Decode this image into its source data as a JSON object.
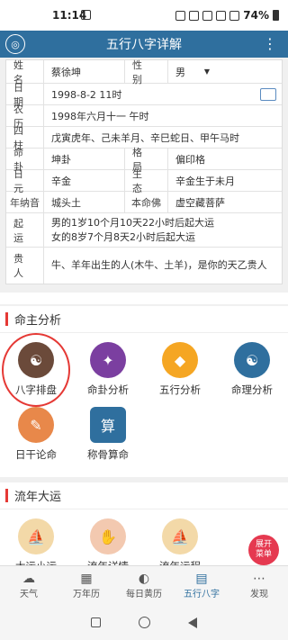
{
  "status": {
    "time": "11:14",
    "battery": "74%"
  },
  "appbar": {
    "title": "五行八字详解"
  },
  "info": {
    "name_label": "姓  名",
    "name_value": "蔡徐坤",
    "gender_label": "性  别",
    "gender_value": "男",
    "date_label": "日  期",
    "date_value": "1998-8-2 11时",
    "lunar_label": "农  历",
    "lunar_value": "1998年六月十一 午时",
    "pillars_label": "四  柱",
    "pillars_value": "戊寅虎年、己未羊月、辛巳蛇日、甲午马时",
    "gua_label": "命  卦",
    "gua_value": "坤卦",
    "geju_label": "格  局",
    "geju_value": "偏印格",
    "riyuan_label": "日  元",
    "riyuan_value": "辛金",
    "shengtai_label": "生  态",
    "shengtai_value": "辛金生于未月",
    "nayin_label": "年纳音",
    "nayin_value": "城头土",
    "benming_label": "本命佛",
    "benming_value": "虚空藏菩萨",
    "qiyun_label": "起  运",
    "qiyun_line1": "男的1岁10个月10天22小时后起大运",
    "qiyun_line2": "女的8岁7个月8天2小时后起大运",
    "guiren_label": "贵  人",
    "guiren_value": "牛、羊年出生的人(木牛、土羊)，是你的天乙贵人"
  },
  "sections": [
    {
      "title": "命主分析",
      "items": [
        {
          "label": "八字排盘",
          "icon": "bagua-icon",
          "color": "#6b4a3a"
        },
        {
          "label": "命卦分析",
          "icon": "dharma-icon",
          "color": "#7b3fa0"
        },
        {
          "label": "五行分析",
          "icon": "gold-ingot-icon",
          "color": "#f5a623"
        },
        {
          "label": "命理分析",
          "icon": "taiji-icon",
          "color": "#2f6f9e"
        },
        {
          "label": "日干论命",
          "icon": "scroll-icon",
          "color": "#e8884a"
        },
        {
          "label": "称骨算命",
          "icon": "abacus-icon",
          "color": "#2f6f9e"
        }
      ]
    },
    {
      "title": "流年大运",
      "items": [
        {
          "label": "大运小运",
          "icon": "sailboat-icon",
          "color": "#f3d9a8"
        },
        {
          "label": "流年详情",
          "icon": "scroll-hand-icon",
          "color": "#f3c9b0"
        },
        {
          "label": "流年运程",
          "icon": "sailboat-icon",
          "color": "#f3d9a8"
        }
      ]
    }
  ],
  "fab": {
    "line1": "展开",
    "line2": "菜单"
  },
  "tabs": [
    {
      "label": "天气",
      "icon": "cloud-icon"
    },
    {
      "label": "万年历",
      "icon": "calendar-icon"
    },
    {
      "label": "每日黄历",
      "icon": "moon-icon"
    },
    {
      "label": "五行八字",
      "icon": "book-icon"
    },
    {
      "label": "发现",
      "icon": "dots-icon"
    }
  ]
}
